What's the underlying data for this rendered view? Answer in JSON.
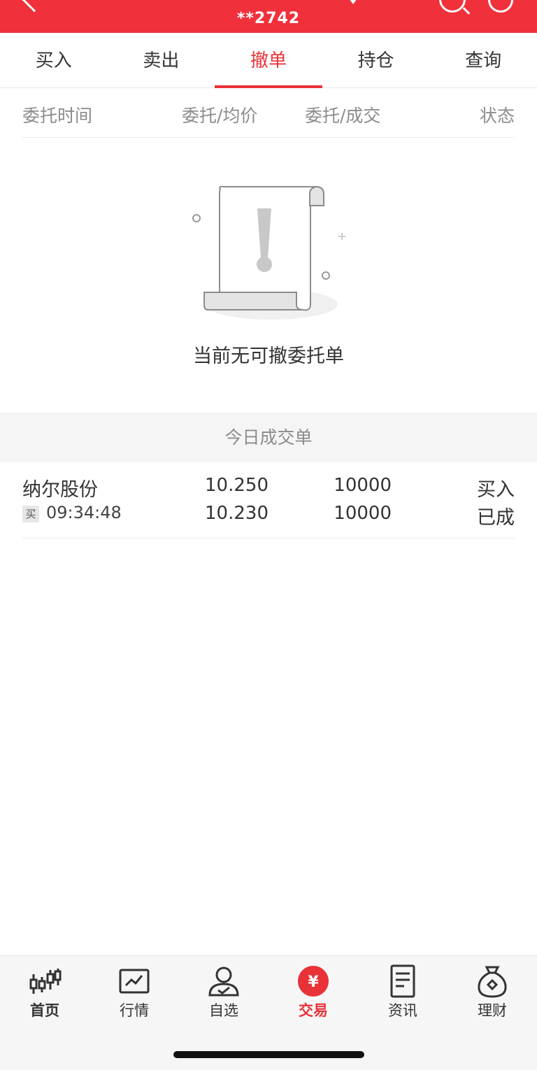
{
  "header": {
    "title": "",
    "account": "**2742"
  },
  "tabs": [
    {
      "label": "买入",
      "active": false
    },
    {
      "label": "卖出",
      "active": false
    },
    {
      "label": "撤单",
      "active": true
    },
    {
      "label": "持仓",
      "active": false
    },
    {
      "label": "查询",
      "active": false
    }
  ],
  "columns": {
    "time": "委托时间",
    "price": "委托/均价",
    "qty": "委托/成交",
    "status": "状态"
  },
  "empty_state": {
    "icon": "empty-document-icon",
    "message": "当前无可撤委托单"
  },
  "today_trades": {
    "title": "今日成交单",
    "rows": [
      {
        "name": "纳尔股份",
        "side_tag": "买",
        "time": "09:34:48",
        "order_price": "10.250",
        "avg_price": "10.230",
        "order_qty": "10000",
        "filled_qty": "10000",
        "direction": "买入",
        "status": "已成"
      }
    ]
  },
  "bottom_nav": [
    {
      "label": "首页",
      "icon": "candlestick-icon",
      "active": false
    },
    {
      "label": "行情",
      "icon": "chart-icon",
      "active": false
    },
    {
      "label": "自选",
      "icon": "user-icon",
      "active": false
    },
    {
      "label": "交易",
      "icon": "yuan-icon",
      "active": true
    },
    {
      "label": "资讯",
      "icon": "document-icon",
      "active": false
    },
    {
      "label": "理财",
      "icon": "money-bag-icon",
      "active": false
    }
  ],
  "colors": {
    "brand": "#f0313b",
    "accent": "#e93238"
  }
}
